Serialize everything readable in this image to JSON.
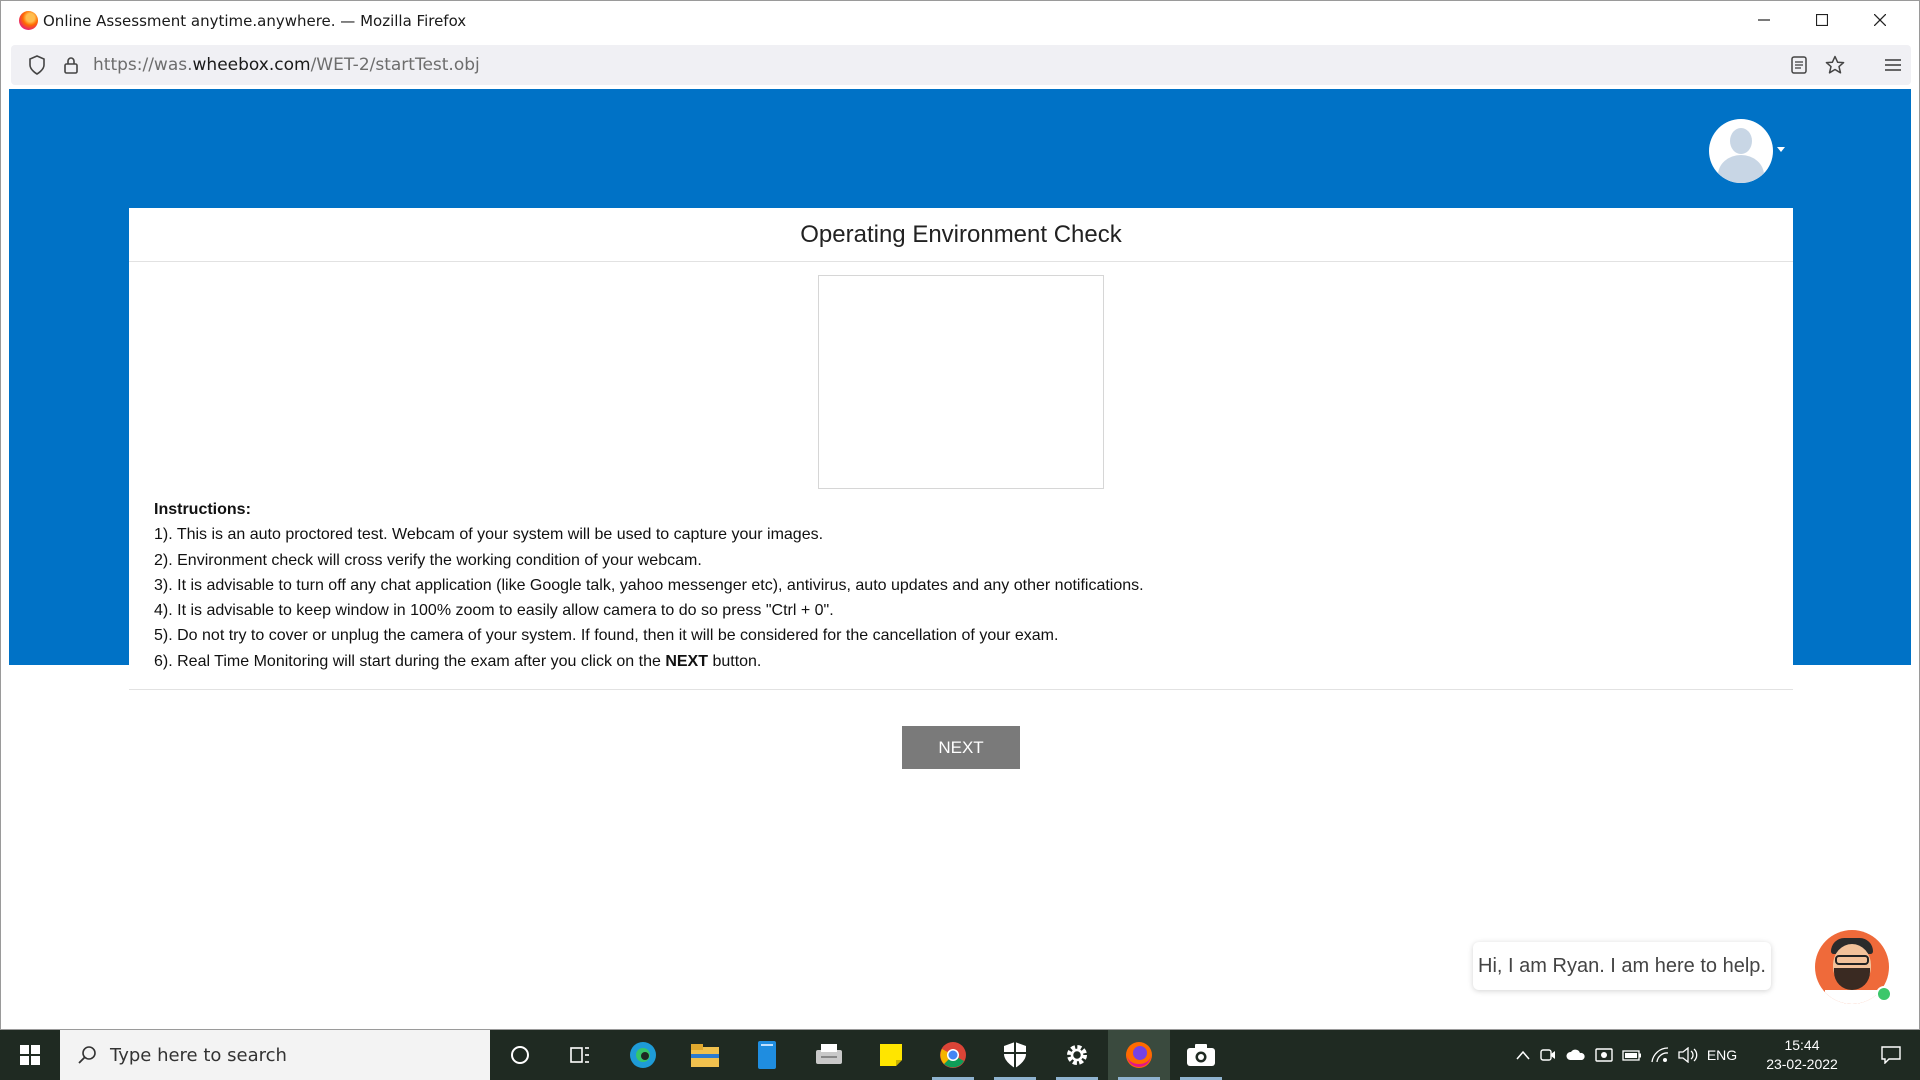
{
  "window": {
    "title": "Online Assessment anytime.anywhere. — Mozilla Firefox",
    "minimize_icon": "minimize-icon",
    "maximize_icon": "maximize-icon",
    "close_icon": "close-icon"
  },
  "navbar": {
    "url_prefix": "https://was.",
    "url_domain": "wheebox.com",
    "url_path": "/WET-2/startTest.obj"
  },
  "page": {
    "title": "Operating Environment Check",
    "instructions_title": "Instructions:",
    "instructions": [
      "1). This is an auto proctored test. Webcam of your system will be used to capture your images.",
      "2). Environment check will cross verify the working condition of your webcam.",
      "3). It is advisable to turn off any chat application (like Google talk, yahoo messenger etc), antivirus, auto updates and any other notifications.",
      "4). It is advisable to keep window in 100% zoom to easily allow camera to do so press \"Ctrl + 0\".",
      "5). Do not try to cover or unplug the camera of your system. If found, then it will be considered for the cancellation of your exam."
    ],
    "instruction6_pre": "6). Real Time Monitoring will start during the exam after you click on the ",
    "instruction6_bold": "NEXT",
    "instruction6_post": " button.",
    "next_label": "NEXT",
    "chat_text": "Hi, I am Ryan. I am here to help."
  },
  "taskbar": {
    "search_placeholder": "Type here to search",
    "tray_lang": "ENG",
    "time": "15:44",
    "date": "23-02-2022"
  },
  "colors": {
    "header_blue": "#0072c6",
    "next_button": "#7a7a7a"
  }
}
